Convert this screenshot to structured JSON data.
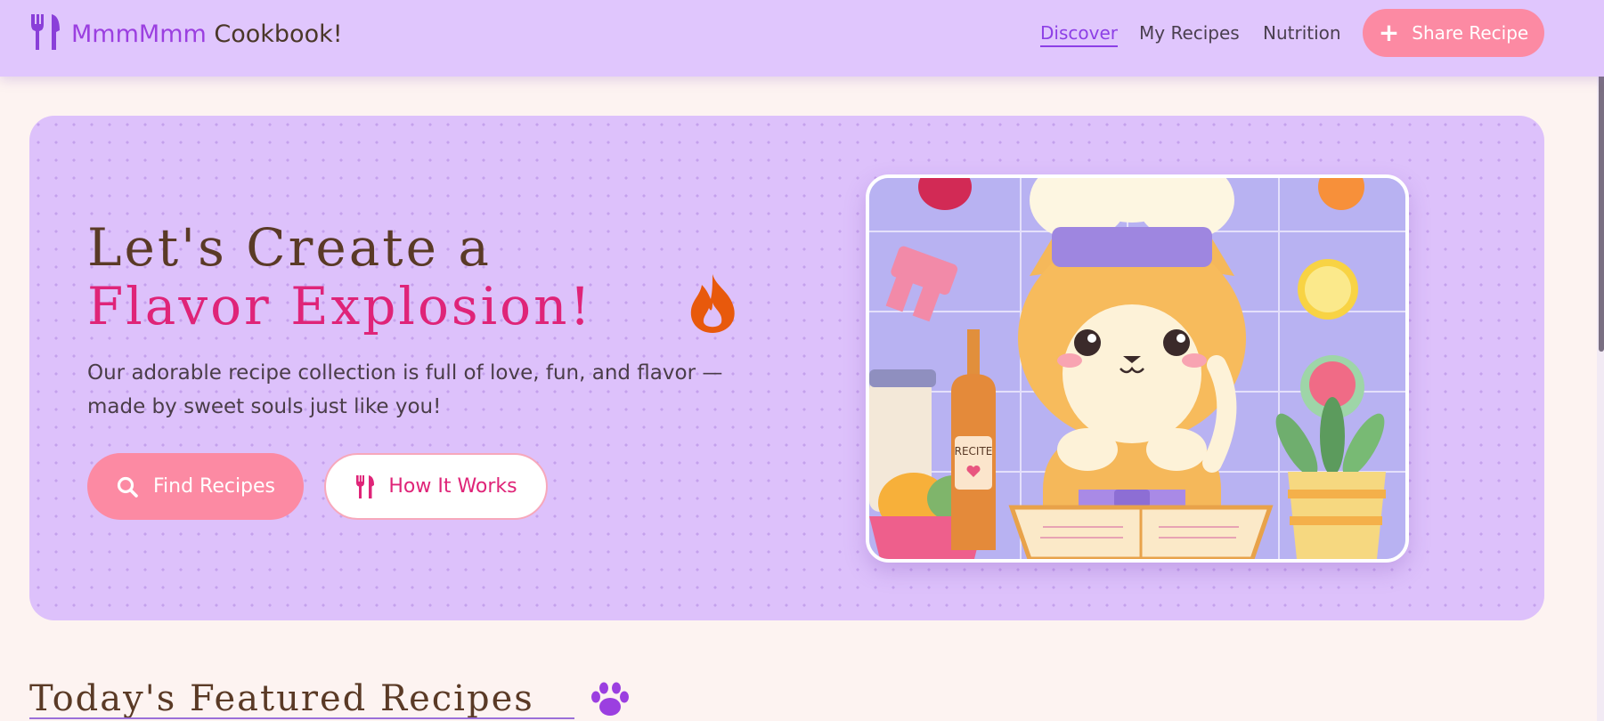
{
  "header": {
    "logo_part1": "MmmMmm",
    "logo_part2": "Cookbook!",
    "logo_icon": "fork-knife-icon",
    "nav": [
      {
        "label": "Discover",
        "active": true
      },
      {
        "label": "My Recipes",
        "active": false
      },
      {
        "label": "Nutrition",
        "active": false
      }
    ],
    "share_button": {
      "label": "Share Recipe",
      "icon": "plus-icon"
    }
  },
  "hero": {
    "title_line1": "Let's Create a",
    "title_line2": "Flavor Explosion!",
    "title_icon": "fire-icon",
    "description": "Our adorable recipe collection is full of love, fun, and flavor — made by sweet souls just like you!",
    "find_button": {
      "label": "Find Recipes",
      "icon": "search-icon"
    },
    "how_button": {
      "label": "How It Works",
      "icon": "utensils-icon"
    },
    "illustration": {
      "bottle_label": "RECITE"
    }
  },
  "featured": {
    "title": "Today's Featured Recipes",
    "icon": "paw-icon"
  },
  "colors": {
    "header_bg": "#e0c6fd",
    "hero_bg": "#ddc1fb",
    "accent_purple": "#9b3fe0",
    "accent_pink": "#df2478",
    "button_pink": "#fc8aa3",
    "brown_text": "#5a3a26",
    "page_bg": "#fdf3f1"
  }
}
